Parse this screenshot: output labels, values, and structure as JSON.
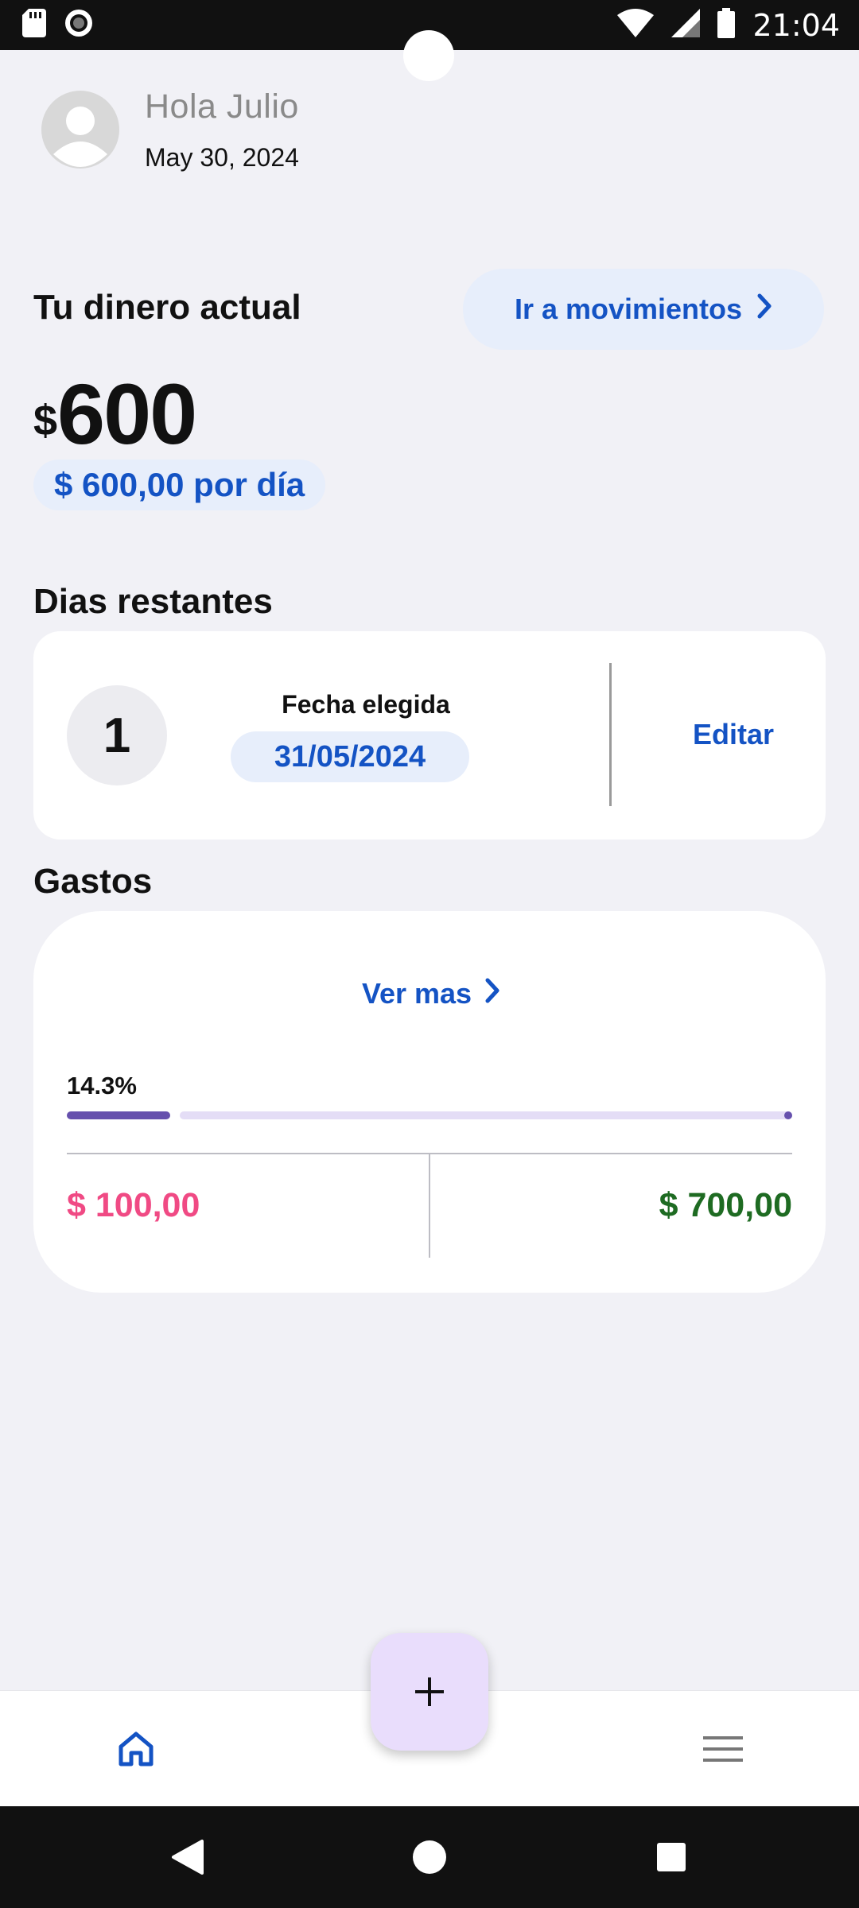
{
  "status_bar": {
    "time": "21:04",
    "icons": [
      "sd-card-icon",
      "record-icon",
      "wifi-icon",
      "signal-icon",
      "battery-icon"
    ]
  },
  "header": {
    "greeting": "Hola Julio",
    "date": "May 30, 2024"
  },
  "balance": {
    "title": "Tu dinero actual",
    "movements_button": "Ir a movimientos",
    "currency_symbol": "$",
    "amount": "600",
    "per_day": "$ 600,00 por día"
  },
  "days": {
    "title": "Dias restantes",
    "remaining": "1",
    "chosen_label": "Fecha elegida",
    "chosen_date": "31/05/2024",
    "edit_label": "Editar"
  },
  "expenses": {
    "title": "Gastos",
    "see_more": "Ver mas",
    "percent_label": "14.3%",
    "progress_fraction": 0.143,
    "spent": "$ 100,00",
    "total": "$ 700,00"
  },
  "colors": {
    "accent_blue": "#1453c4",
    "spent_pink": "#f04a84",
    "total_green": "#1e6b22",
    "progress_purple": "#6650ad",
    "fab_bg": "#e9ddfc"
  },
  "bottom_nav": {
    "items": [
      "home-icon",
      "menu-icon"
    ],
    "fab_icon": "plus-icon"
  }
}
